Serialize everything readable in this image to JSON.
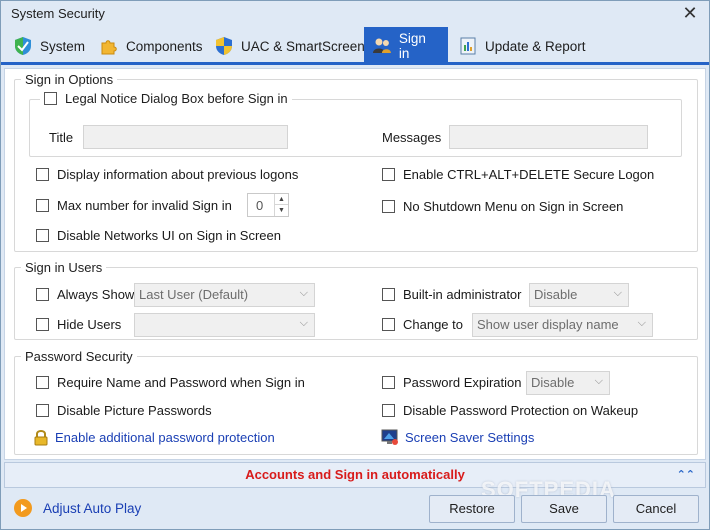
{
  "window": {
    "title": "System Security"
  },
  "tabs": [
    {
      "label": "System",
      "icon": "shield-check-icon"
    },
    {
      "label": "Components",
      "icon": "puzzle-piece-icon"
    },
    {
      "label": "UAC & SmartScreen",
      "icon": "uac-shield-icon"
    },
    {
      "label": "Sign in",
      "icon": "users-icon",
      "active": true
    },
    {
      "label": "Update & Report",
      "icon": "report-icon"
    }
  ],
  "sign_in_options": {
    "legend": "Sign in Options",
    "legal_notice": {
      "label": "Legal Notice Dialog Box before Sign in",
      "checked": false,
      "title_label": "Title",
      "title_value": "",
      "messages_label": "Messages",
      "messages_value": ""
    },
    "display_prev_logons": {
      "label": "Display information about previous logons",
      "checked": false
    },
    "max_invalid": {
      "label": "Max number for invalid Sign in",
      "checked": false,
      "value": "0"
    },
    "disable_network_ui": {
      "label": "Disable Networks UI on Sign in Screen",
      "checked": false
    },
    "ctrl_alt_del": {
      "label": "Enable CTRL+ALT+DELETE Secure Logon",
      "checked": false
    },
    "no_shutdown": {
      "label": "No Shutdown Menu on Sign in Screen",
      "checked": false
    }
  },
  "sign_in_users": {
    "legend": "Sign in Users",
    "always_show": {
      "label": "Always Show",
      "checked": false,
      "select_value": "Last User (Default)"
    },
    "hide_users": {
      "label": "Hide Users",
      "checked": false,
      "select_value": ""
    },
    "builtin_admin": {
      "label": "Built-in administrator",
      "checked": false,
      "select_value": "Disable"
    },
    "change_to": {
      "label": "Change to",
      "checked": false,
      "select_value": "Show user display name"
    }
  },
  "password_security": {
    "legend": "Password Security",
    "require_name_pwd": {
      "label": "Require Name and Password when Sign in",
      "checked": false
    },
    "disable_picture_pwd": {
      "label": "Disable Picture Passwords",
      "checked": false
    },
    "additional_protection_link": "Enable additional password protection",
    "pwd_expiration": {
      "label": "Password Expiration",
      "checked": false,
      "select_value": "Disable"
    },
    "disable_wakeup_pwd": {
      "label": "Disable Password Protection on Wakeup",
      "checked": false
    },
    "screen_saver_link": "Screen Saver Settings"
  },
  "banner": {
    "text": "Accounts and Sign in automatically",
    "color": "#d81b1b"
  },
  "footer": {
    "adjust_autoplay": "Adjust Auto Play",
    "restore": "Restore",
    "save": "Save",
    "cancel": "Cancel"
  },
  "watermark": "SOFTPEDIA",
  "colors": {
    "accent": "#2563c7",
    "link": "#1a3fb4",
    "background": "#dfe9f5"
  }
}
